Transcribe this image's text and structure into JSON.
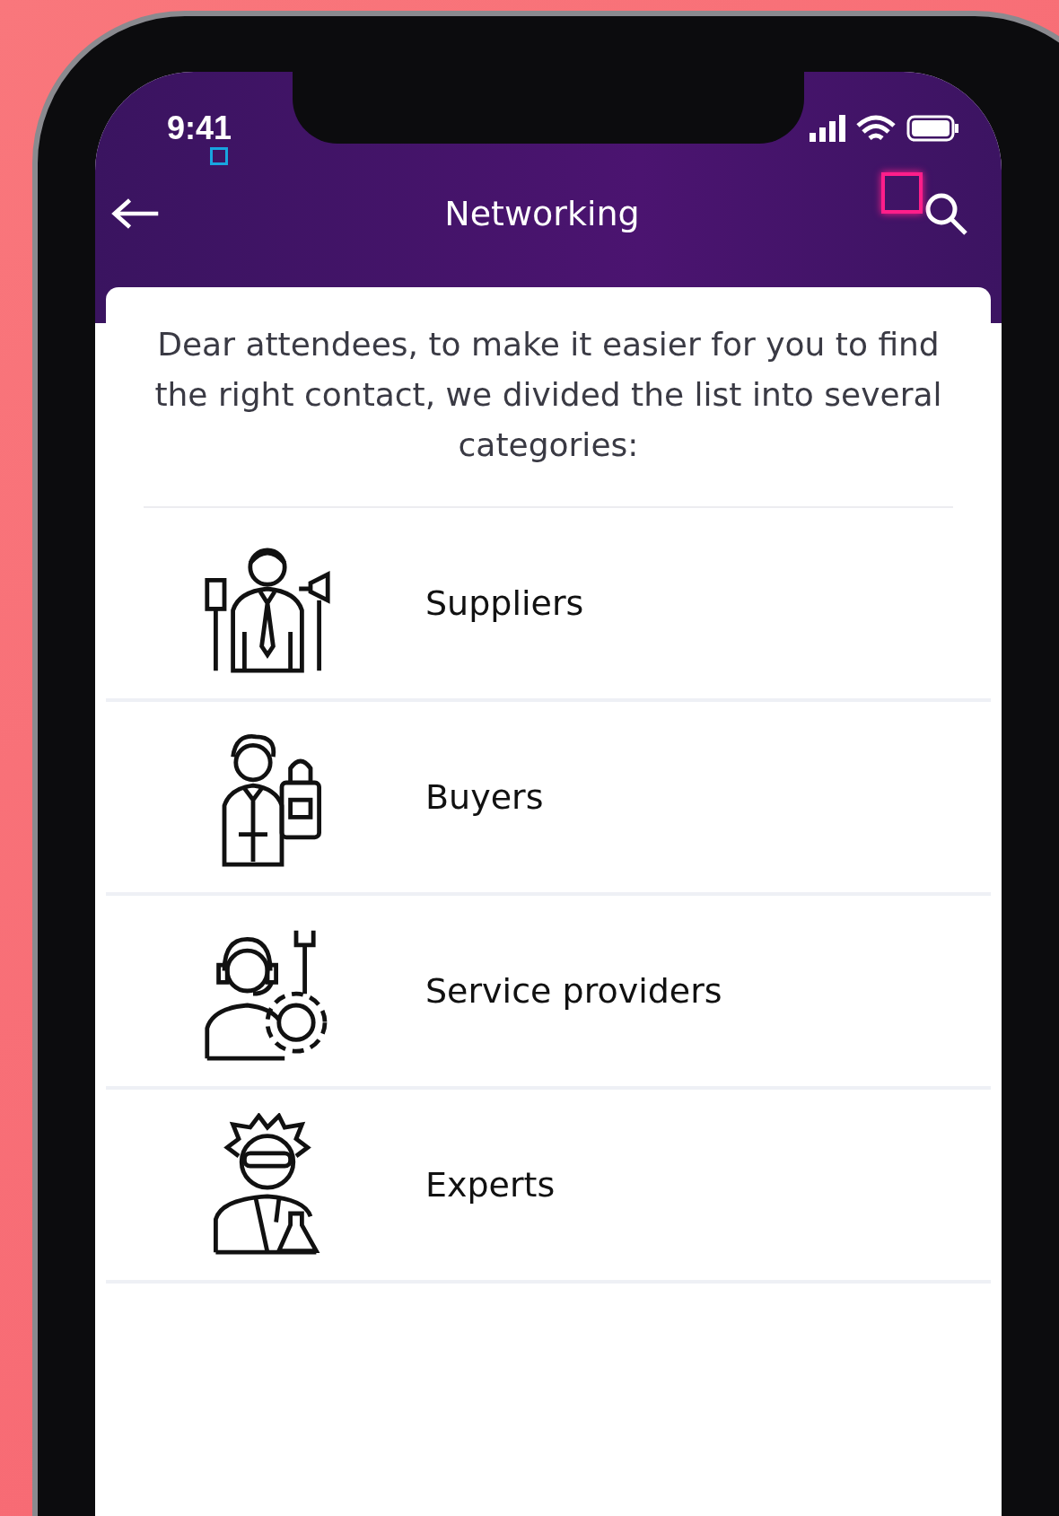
{
  "status_bar": {
    "time": "9:41"
  },
  "header": {
    "title": "Networking"
  },
  "intro": "Dear attendees, to make it easier for you to find the right contact, we divided the list into several categories:",
  "categories": [
    {
      "label": "Suppliers",
      "kind": "supplier"
    },
    {
      "label": "Buyers",
      "kind": "buyer"
    },
    {
      "label": "Service providers",
      "kind": "service"
    },
    {
      "label": "Experts",
      "kind": "expert"
    }
  ]
}
